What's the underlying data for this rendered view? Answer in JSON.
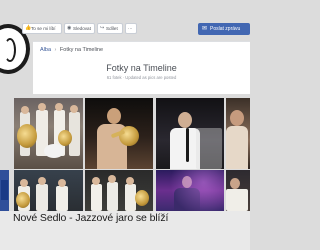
{
  "toolbar": {
    "liked_label": "To se mi líbí",
    "follow_label": "Sledovat",
    "share_label": "Sdílet",
    "more_label": "···",
    "message_label": "Poslat zprávu"
  },
  "breadcrumb": {
    "parent": "Alba",
    "separator": "›",
    "current": "Fotky na Timeline"
  },
  "album": {
    "title": "Fotky na Timeline",
    "subtitle": "61 fotek · Updated as pics are posted"
  },
  "caption": "Nové Sedlo - Jazzové jaro se blíží"
}
